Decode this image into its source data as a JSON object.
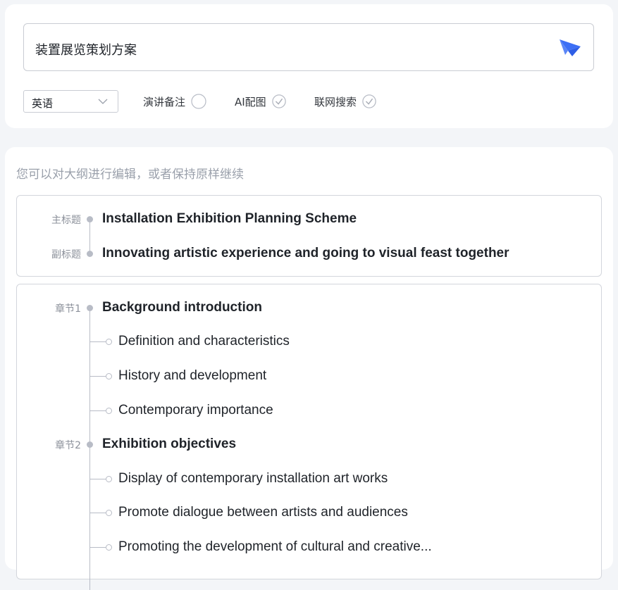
{
  "prompt": {
    "value": "装置展览策划方案",
    "send_icon": "send-paper-plane-icon",
    "accent": "#3d6ff5"
  },
  "options": {
    "language": "英语",
    "speaker_notes": {
      "label": "演讲备注",
      "checked": false
    },
    "ai_images": {
      "label": "AI配图",
      "checked": true
    },
    "web_search": {
      "label": "联网搜索",
      "checked": true
    }
  },
  "outline": {
    "hint": "您可以对大纲进行编辑，或者保持原样继续",
    "title_tag": "主标题",
    "title": "Installation Exhibition Planning Scheme",
    "subtitle_tag": "副标题",
    "subtitle": "Innovating artistic experience and going to visual feast together",
    "chapters": [
      {
        "tag": "章节1",
        "title": "Background introduction",
        "items": [
          "Definition and characteristics",
          "History and development",
          "Contemporary importance"
        ]
      },
      {
        "tag": "章节2",
        "title": "Exhibition objectives",
        "items": [
          "Display of contemporary installation art works",
          "Promote dialogue between artists and audiences",
          "Promoting the development of cultural and creative..."
        ]
      }
    ]
  }
}
